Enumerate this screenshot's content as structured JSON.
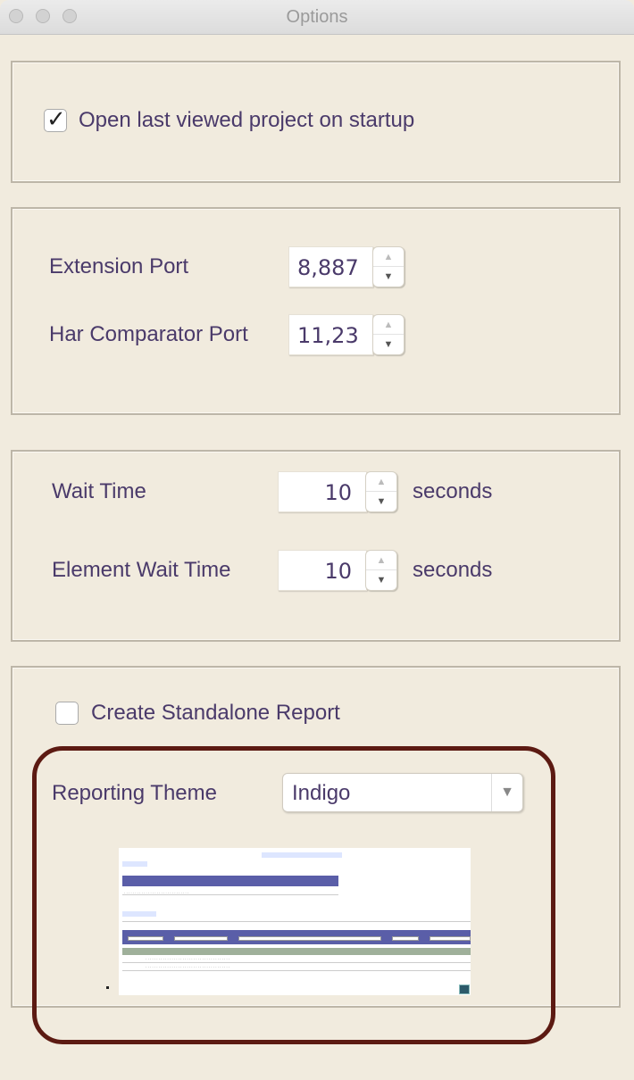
{
  "window": {
    "title": "Options"
  },
  "startup": {
    "open_last_label": "Open last viewed project on startup",
    "open_last_checked": true
  },
  "ports": {
    "extension_label": "Extension Port",
    "extension_value": "8,887",
    "har_label": "Har Comparator Port",
    "har_value": "11,23"
  },
  "waits": {
    "wait_label": "Wait Time",
    "wait_value": "10",
    "wait_unit": "seconds",
    "element_label": "Element Wait Time",
    "element_value": "10",
    "element_unit": "seconds"
  },
  "report": {
    "standalone_label": "Create Standalone Report",
    "standalone_checked": false,
    "theme_label": "Reporting Theme",
    "theme_value": "Indigo",
    "highlight_color": "#5c1a12",
    "theme_color": "#5a5ea8"
  },
  "icons": {
    "checkmark": "checkmark-icon",
    "spinner_up": "triangle-up-icon",
    "spinner_down": "triangle-down-icon",
    "dropdown": "chevron-down-icon"
  }
}
